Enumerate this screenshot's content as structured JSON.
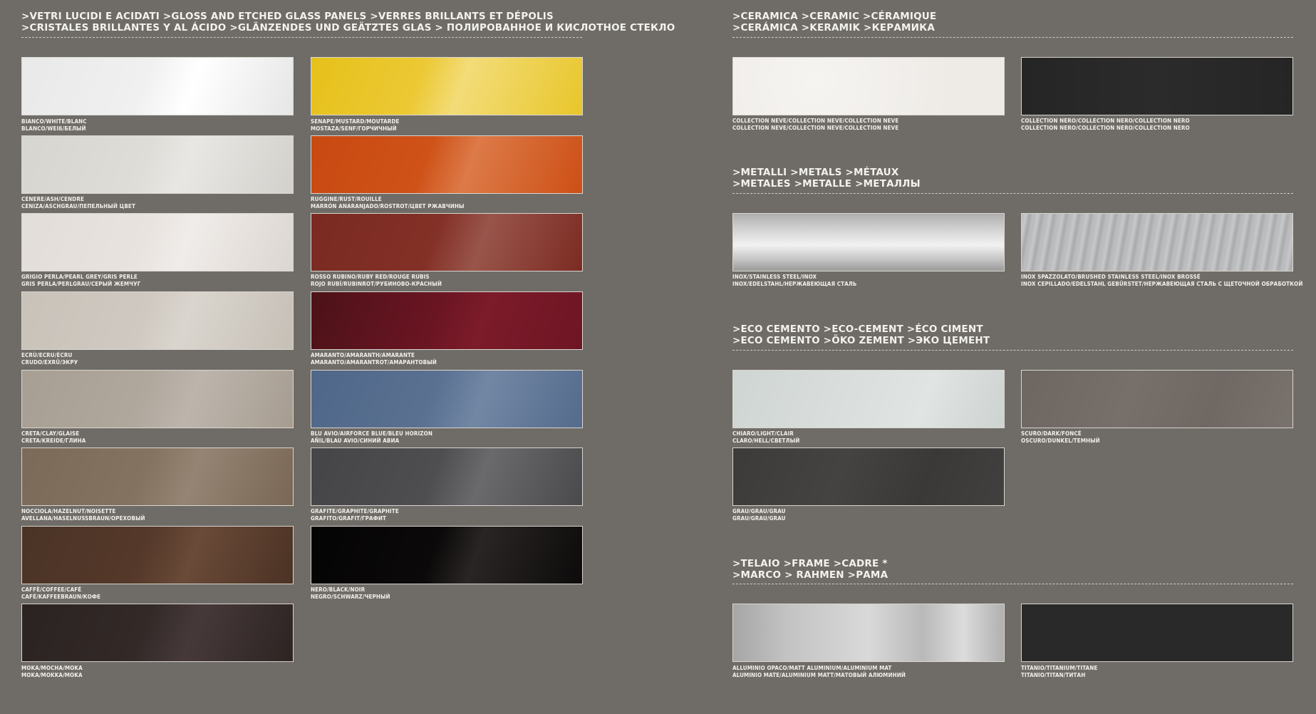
{
  "glass": {
    "heading_line1": ">VETRI LUCIDI E ACIDATI >GLOSS AND ETCHED GLASS PANELS >VERRES BRILLANTS ET DÉPOLIS",
    "heading_line2": ">CRISTALES BRILLANTES Y AL ÁCIDO >GLÄNZENDES UND GEÄTZTES GLAS > ПОЛИРОВАННОЕ И КИСЛОТНОЕ СТЕКЛО",
    "swatches": [
      {
        "line1": "BIANCO/WHITE/BLANC",
        "line2": "BLANCO/WEIß/БЕЛЫЙ"
      },
      {
        "line1": "SENAPE/MUSTARD/MOUTARDE",
        "line2": "MOSTAZA/SENF/ГОРЧИЧНЫЙ"
      },
      {
        "line1": "CENERE/ASH/CENDRE",
        "line2": "CENIZA/ASCHGRAU/ПЕПЕЛЬНЫЙ ЦВЕТ"
      },
      {
        "line1": "RUGGINE/RUST/ROUILLE",
        "line2": "MARRÓN ANARANJADO/ROSTROT/ЦВЕТ РЖАВЧИНЫ"
      },
      {
        "line1": "GRIGIO PERLA/PEARL GREY/GRIS PERLE",
        "line2": "GRIS PERLA/PERLGRAU/СЕРЫЙ ЖЕМЧУГ"
      },
      {
        "line1": "ROSSO RUBINO/RUBY RED/ROUGE RUBIS",
        "line2": "ROJO RUBÍ/RUBINROT/РУБИНОВО-КРАСНЫЙ"
      },
      {
        "line1": "ECRÙ/ECRU/ÉCRU",
        "line2": "CRUDO/EXRÜ/ЭКРУ"
      },
      {
        "line1": "AMARANTO/AMARANTH/AMARANTE",
        "line2": "AMARANTO/AMARANTROT/АМАРАНТОВЫЙ"
      },
      {
        "line1": "CRETA/CLAY/GLAISE",
        "line2": "CRETA/KREIDE/ГЛИНА"
      },
      {
        "line1": "BLU AVIO/AIRFORCE BLUE/BLEU HORIZON",
        "line2": "AÑIL/BLAU AVIO/СИНИЙ АВИА"
      },
      {
        "line1": "NOCCIOLA/HAZELNUT/NOISETTE",
        "line2": "AVELLANA/HASELNUSSBRAUN/ОРЕХОВЫЙ"
      },
      {
        "line1": "GRAFITE/GRAPHITE/GRAPHITE",
        "line2": "GRAFITO/GRAFIT/ГРАФИТ"
      },
      {
        "line1": "CAFFÈ/COFFEE/CAFÉ",
        "line2": "CAFÉ/KAFFEEBRAUN/КОФЕ"
      },
      {
        "line1": "NERO/BLACK/NOIR",
        "line2": "NEGRO/SCHWARZ/ЧЕРНЫЙ"
      },
      {
        "line1": "MOKA/MOCHA/MOKA",
        "line2": "MOKA/MOKKA/MOKA"
      }
    ]
  },
  "ceramic": {
    "heading_line1": ">CERAMICA >CERAMIC >CÉRAMIQUE",
    "heading_line2": ">CERÁMICA >KERAMIK >КЕРАМИКА",
    "swatches": [
      {
        "line1": "COLLECTION NEVE/COLLECTION NEVE/COLLECTION NEVE",
        "line2": "COLLECTION NEVE/COLLECTION NEVE/COLLECTION NEVE"
      },
      {
        "line1": "COLLECTION NERO/COLLECTION NERO/COLLECTION NERO",
        "line2": "COLLECTION NERO/COLLECTION NERO/COLLECTION NERO"
      }
    ]
  },
  "metals": {
    "heading_line1": ">METALLI >METALS >MÉTAUX",
    "heading_line2": ">METALES >METALLE >МЕТАЛЛЫ",
    "swatches": [
      {
        "line1": "INOX/STAINLESS STEEL/INOX",
        "line2": "INOX/EDELSTAHL/НЕРЖАВЕЮЩАЯ СТАЛЬ"
      },
      {
        "line1": "INOX SPAZZOLATO/BRUSHED STAINLESS STEEL/INOX BROSSÉ",
        "line2": "INOX CEPILLADO/EDELSTAHL GEBÜRSTET/НЕРЖАВЕЮЩАЯ СТАЛЬ С ЩЕТОЧНОЙ ОБРАБОТКОЙ"
      }
    ]
  },
  "eco": {
    "heading_line1": ">ECO CEMENTO >ECO-CEMENT >ÉCO CIMENT",
    "heading_line2": ">ECO CEMENTO >ÖKO ZEMENT >ЭКО ЦЕМЕНТ",
    "swatches": [
      {
        "line1": "CHIARO/LIGHT/CLAIR",
        "line2": "CLARO/HELL/СВЕТЛЫЙ"
      },
      {
        "line1": "SCURO/DARK/FONCÉ",
        "line2": "OSCURO/DUNKEL/ТЕМНЫЙ"
      },
      {
        "line1": "GRAU/GRAU/GRAU",
        "line2": "GRAU/GRAU/GRAU"
      }
    ]
  },
  "frame": {
    "heading_line1": ">TELAIO >FRAME >CADRE *",
    "heading_line2": ">MARCO > RAHMEN >РАМА",
    "swatches": [
      {
        "line1": "ALLUMINIO OPACO/MATT ALUMINIUM/ALUMINIUM MAT",
        "line2": "ALUMINIO MATE/ALUMINIUM MATT/МАТОВЫЙ АЛЮМИНИЙ"
      },
      {
        "line1": "TITANIO/TITANIUM/TITANE",
        "line2": "TITANIO/TITAN/ТИТАН"
      }
    ]
  }
}
